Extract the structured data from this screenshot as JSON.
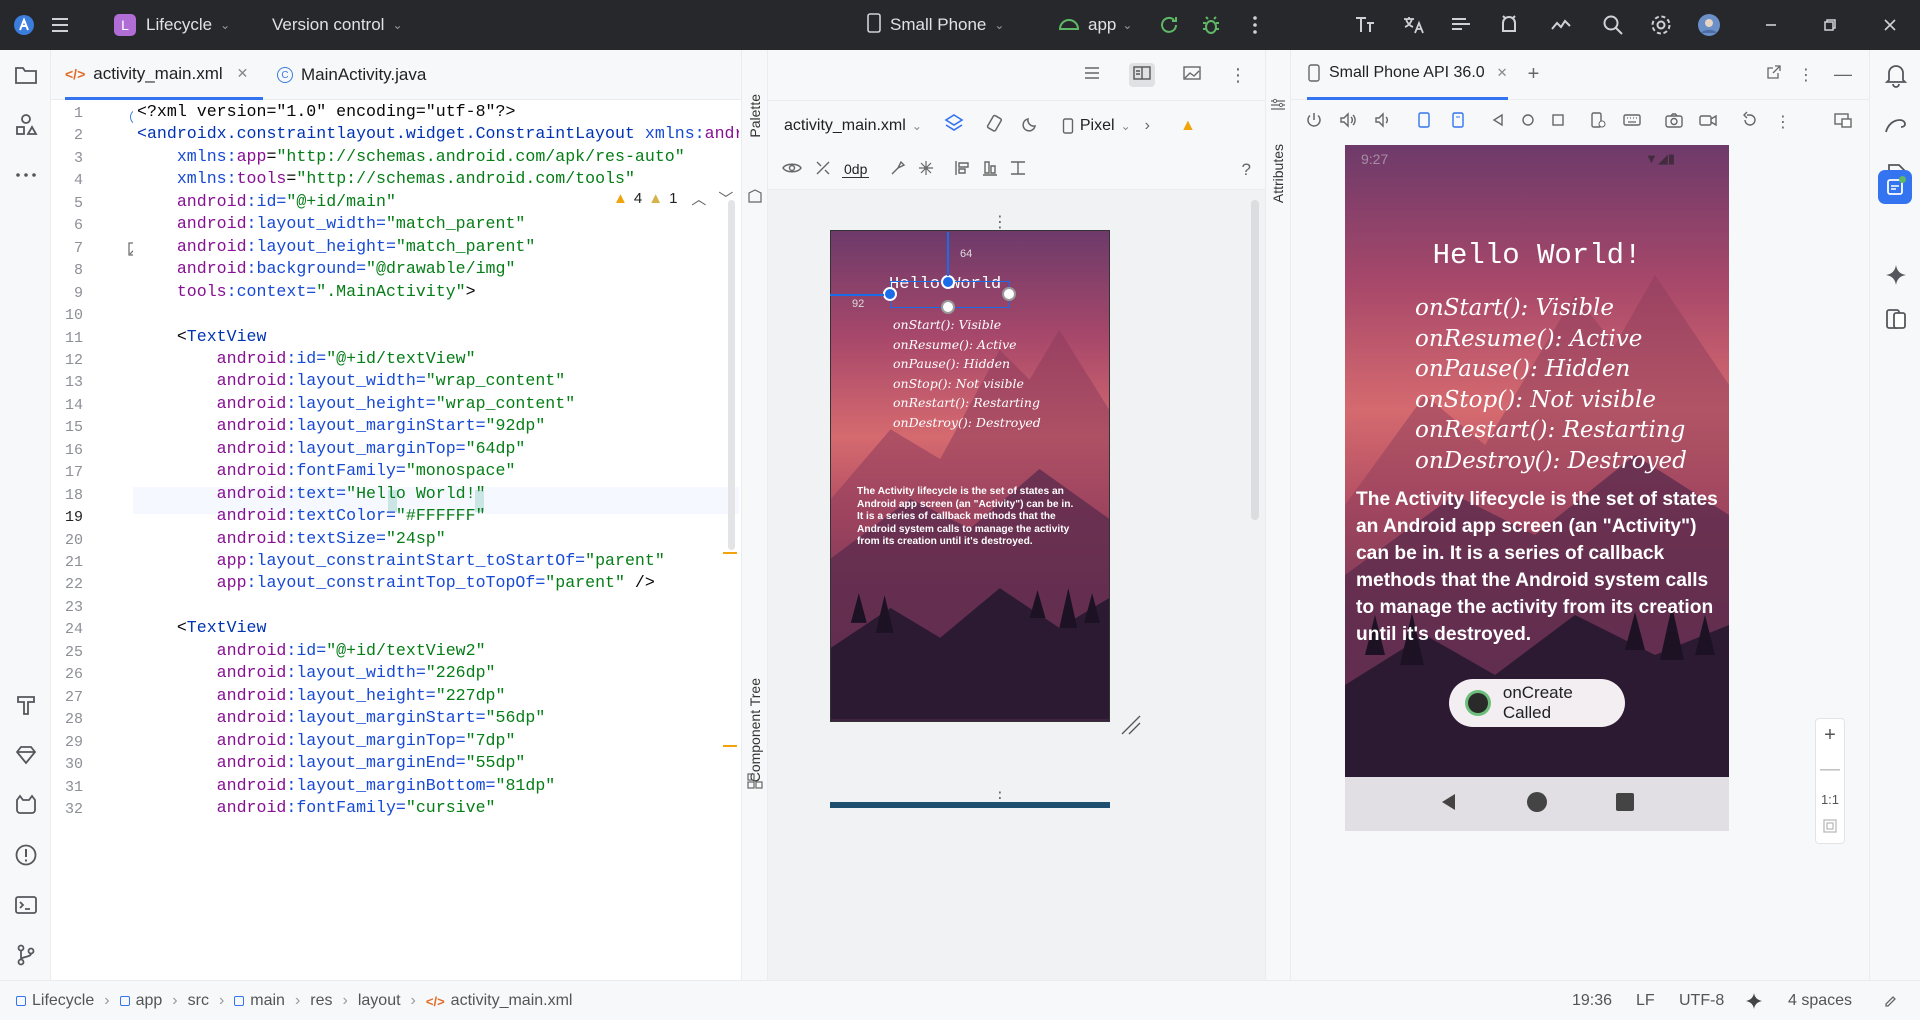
{
  "titlebar": {
    "project_initial": "L",
    "project_name": "Lifecycle",
    "vcs_label": "Version control",
    "device": "Small Phone",
    "run_config": "app"
  },
  "editor": {
    "tabs": [
      {
        "label": "activity_main.xml"
      },
      {
        "label": "MainActivity.java"
      }
    ],
    "warnings": "4",
    "weak_warnings": "1",
    "line_numbers": [
      "1",
      "2",
      "3",
      "4",
      "5",
      "6",
      "7",
      "8",
      "9",
      "10",
      "11",
      "12",
      "13",
      "14",
      "15",
      "16",
      "17",
      "18",
      "19",
      "20",
      "21",
      "22",
      "23",
      "24",
      "25",
      "26",
      "27",
      "28",
      "29",
      "30",
      "31",
      "32"
    ],
    "lines": [
      [
        {
          "t": "<?xml version=\"1.0\" encoding=\"utf-8\"?>",
          "c": ""
        }
      ],
      [
        {
          "t": "<androidx.constraintlayout.widget.ConstraintLayout ",
          "c": "tg"
        },
        {
          "t": "xmlns:",
          "c": "at"
        },
        {
          "t": "android",
          "c": "ns"
        }
      ],
      [
        {
          "t": "    xmlns:",
          "c": "at"
        },
        {
          "t": "app",
          "c": "ns"
        },
        {
          "t": "=",
          "c": ""
        },
        {
          "t": "\"http://schemas.android.com/apk/res-auto\"",
          "c": "st"
        }
      ],
      [
        {
          "t": "    xmlns:",
          "c": "at"
        },
        {
          "t": "tools",
          "c": "ns"
        },
        {
          "t": "=",
          "c": ""
        },
        {
          "t": "\"http://schemas.android.com/tools\"",
          "c": "st"
        }
      ],
      [
        {
          "t": "    android",
          "c": "ns"
        },
        {
          "t": ":id=",
          "c": "at"
        },
        {
          "t": "\"@+id/main\"",
          "c": "st"
        }
      ],
      [
        {
          "t": "    android",
          "c": "ns"
        },
        {
          "t": ":layout_width=",
          "c": "at"
        },
        {
          "t": "\"match_parent\"",
          "c": "st"
        }
      ],
      [
        {
          "t": "    android",
          "c": "ns"
        },
        {
          "t": ":layout_height=",
          "c": "at"
        },
        {
          "t": "\"match_parent\"",
          "c": "st"
        }
      ],
      [
        {
          "t": "    android",
          "c": "ns"
        },
        {
          "t": ":background=",
          "c": "at"
        },
        {
          "t": "\"@drawable/img\"",
          "c": "st"
        }
      ],
      [
        {
          "t": "    tools",
          "c": "ns"
        },
        {
          "t": ":context=",
          "c": "at"
        },
        {
          "t": "\".MainActivity\"",
          "c": "st"
        },
        {
          "t": ">",
          "c": ""
        }
      ],
      [
        {
          "t": "",
          "c": ""
        }
      ],
      [
        {
          "t": "    <",
          "c": ""
        },
        {
          "t": "TextView",
          "c": "tg"
        }
      ],
      [
        {
          "t": "        android",
          "c": "ns"
        },
        {
          "t": ":id=",
          "c": "at"
        },
        {
          "t": "\"@+id/textView\"",
          "c": "st"
        }
      ],
      [
        {
          "t": "        android",
          "c": "ns"
        },
        {
          "t": ":layout_width=",
          "c": "at"
        },
        {
          "t": "\"wrap_content\"",
          "c": "st"
        }
      ],
      [
        {
          "t": "        android",
          "c": "ns"
        },
        {
          "t": ":layout_height=",
          "c": "at"
        },
        {
          "t": "\"wrap_content\"",
          "c": "st"
        }
      ],
      [
        {
          "t": "        android",
          "c": "ns"
        },
        {
          "t": ":layout_marginStart=",
          "c": "at"
        },
        {
          "t": "\"92dp\"",
          "c": "st"
        }
      ],
      [
        {
          "t": "        android",
          "c": "ns"
        },
        {
          "t": ":layout_marginTop=",
          "c": "at"
        },
        {
          "t": "\"64dp\"",
          "c": "st"
        }
      ],
      [
        {
          "t": "        android",
          "c": "ns"
        },
        {
          "t": ":fontFamily=",
          "c": "at"
        },
        {
          "t": "\"monospace\"",
          "c": "st"
        }
      ],
      [
        {
          "t": "        android",
          "c": "ns"
        },
        {
          "t": ":text=",
          "c": "at"
        },
        {
          "t": "\"Hello World!\"",
          "c": "st"
        }
      ],
      [
        {
          "t": "        android",
          "c": "ns"
        },
        {
          "t": ":textColor=",
          "c": "at"
        },
        {
          "t": "\"#FFFFFF\"",
          "c": "st"
        }
      ],
      [
        {
          "t": "        android",
          "c": "ns"
        },
        {
          "t": ":textSize=",
          "c": "at"
        },
        {
          "t": "\"24sp\"",
          "c": "st"
        }
      ],
      [
        {
          "t": "        app",
          "c": "ns"
        },
        {
          "t": ":layout_constraintStart_toStartOf=",
          "c": "at"
        },
        {
          "t": "\"parent\"",
          "c": "st"
        }
      ],
      [
        {
          "t": "        app",
          "c": "ns"
        },
        {
          "t": ":layout_constraintTop_toTopOf=",
          "c": "at"
        },
        {
          "t": "\"parent\"",
          "c": "st"
        },
        {
          "t": " />",
          "c": ""
        }
      ],
      [
        {
          "t": "",
          "c": ""
        }
      ],
      [
        {
          "t": "    <",
          "c": ""
        },
        {
          "t": "TextView",
          "c": "tg"
        }
      ],
      [
        {
          "t": "        android",
          "c": "ns"
        },
        {
          "t": ":id=",
          "c": "at"
        },
        {
          "t": "\"@+id/textView2\"",
          "c": "st"
        }
      ],
      [
        {
          "t": "        android",
          "c": "ns"
        },
        {
          "t": ":layout_width=",
          "c": "at"
        },
        {
          "t": "\"226dp\"",
          "c": "st"
        }
      ],
      [
        {
          "t": "        android",
          "c": "ns"
        },
        {
          "t": ":layout_height=",
          "c": "at"
        },
        {
          "t": "\"227dp\"",
          "c": "st"
        }
      ],
      [
        {
          "t": "        android",
          "c": "ns"
        },
        {
          "t": ":layout_marginStart=",
          "c": "at"
        },
        {
          "t": "\"56dp\"",
          "c": "st"
        }
      ],
      [
        {
          "t": "        android",
          "c": "ns"
        },
        {
          "t": ":layout_marginTop=",
          "c": "at"
        },
        {
          "t": "\"7dp\"",
          "c": "st"
        }
      ],
      [
        {
          "t": "        android",
          "c": "ns"
        },
        {
          "t": ":layout_marginEnd=",
          "c": "at"
        },
        {
          "t": "\"55dp\"",
          "c": "st"
        }
      ],
      [
        {
          "t": "        android",
          "c": "ns"
        },
        {
          "t": ":layout_marginBottom=",
          "c": "at"
        },
        {
          "t": "\"81dp\"",
          "c": "st"
        }
      ],
      [
        {
          "t": "        android",
          "c": "ns"
        },
        {
          "t": ":fontFamily=",
          "c": "at"
        },
        {
          "t": "\"cursive\"",
          "c": "st"
        }
      ]
    ]
  },
  "designer": {
    "file_dropdown": "activity_main.xml",
    "device_dropdown": "Pixel",
    "margin_value": "0dp",
    "palette_label": "Palette",
    "component_tree_label": "Component Tree",
    "attributes_label": "Attributes",
    "constraint_top": "64",
    "constraint_start": "92"
  },
  "app_screen": {
    "hello": "Hello World!",
    "preview_hello": "Hello World",
    "lifecycle": [
      "onStart(): Visible",
      "onResume(): Active",
      "onPause(): Hidden",
      "onStop(): Not visible",
      "onRestart(): Restarting",
      "onDestroy(): Destroyed"
    ],
    "description": "The Activity lifecycle is the set of states an Android app screen (an \"Activity\") can be in. It is a series of callback methods that the Android system calls to manage the activity from its creation until it's destroyed.",
    "toast": "onCreate Called",
    "status_time": "9:27"
  },
  "emulator": {
    "tab_label": "Small Phone API 36.0",
    "zoom_label": "1:1"
  },
  "statusbar": {
    "breadcrumbs": [
      "Lifecycle",
      "app",
      "src",
      "main",
      "res",
      "layout",
      "activity_main.xml"
    ],
    "position": "19:36",
    "line_sep": "LF",
    "encoding": "UTF-8",
    "indent": "4 spaces"
  },
  "colors": {
    "accent": "#3574f0",
    "titlebar": "#27282c",
    "project_badge": "#b06dd6",
    "warning": "#f0a30a"
  }
}
